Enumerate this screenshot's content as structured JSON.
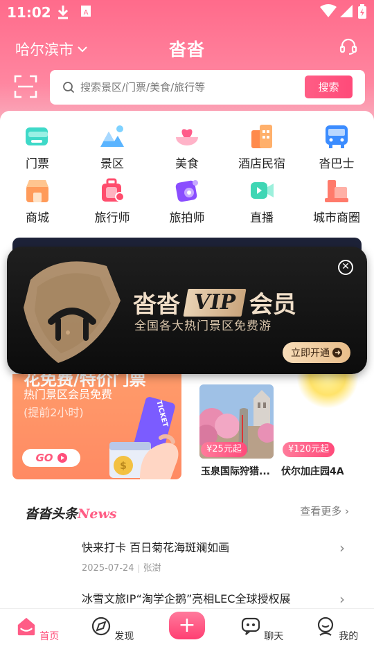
{
  "status_bar": {
    "time": "11:02"
  },
  "header": {
    "city": "哈尔滨市",
    "title": "沓沓"
  },
  "search": {
    "placeholder": "搜索景区/门票/美食/旅行等",
    "button_label": "搜索"
  },
  "categories": [
    {
      "label": "门票",
      "icon": "ticket-icon"
    },
    {
      "label": "景区",
      "icon": "scenic-icon"
    },
    {
      "label": "美食",
      "icon": "food-icon"
    },
    {
      "label": "酒店民宿",
      "icon": "hotel-icon"
    },
    {
      "label": "沓巴士",
      "icon": "bus-icon"
    },
    {
      "label": "商城",
      "icon": "mall-icon"
    },
    {
      "label": "旅行师",
      "icon": "travel-advisor-icon"
    },
    {
      "label": "旅拍师",
      "icon": "photographer-icon"
    },
    {
      "label": "直播",
      "icon": "live-icon"
    },
    {
      "label": "城市商圈",
      "icon": "city-business-icon"
    }
  ],
  "vip_popup": {
    "brand": "沓沓",
    "badge": "VIP",
    "suffix": "会员",
    "subtitle": "全国各大热门景区免费游",
    "button_label": "立即开通"
  },
  "promo_left": {
    "title": "花免费/特价门票",
    "line1": "热门景区会员免费",
    "line2": "(提前2小时)",
    "go_label": "GO",
    "ticket_text": "TICKET"
  },
  "promo_right": {
    "spots": [
      {
        "price": "¥25元起",
        "name": "玉泉国际狩猎..."
      },
      {
        "price": "¥120元起",
        "name": "伏尔加庄园4A"
      }
    ]
  },
  "news": {
    "brand_cn": "沓沓头条",
    "brand_en": "News",
    "more_label": "查看更多",
    "items": [
      {
        "title": "快来打卡 百日菊花海斑斓如画",
        "date": "2025-07-24",
        "author": "张澍"
      },
      {
        "title": "冰雪文旅IP“淘学企鹅”亮相LEC全球授权展"
      }
    ]
  },
  "bottom_nav": {
    "home": "首页",
    "discover": "发现",
    "chat": "聊天",
    "mine": "我的"
  },
  "colors": {
    "brand": "#ff4f7b",
    "header_top": "#ff6b8b",
    "vip_gold": "#e8bd8a"
  }
}
